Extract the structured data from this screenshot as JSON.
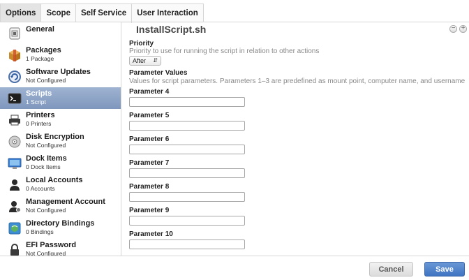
{
  "tabs": [
    "Options",
    "Scope",
    "Self Service",
    "User Interaction"
  ],
  "sidebar": {
    "items": [
      {
        "label": "General",
        "sub": "",
        "icon": "general-icon"
      },
      {
        "label": "Packages",
        "sub": "1 Package",
        "icon": "package-icon"
      },
      {
        "label": "Software Updates",
        "sub": "Not Configured",
        "icon": "software-updates-icon"
      },
      {
        "label": "Scripts",
        "sub": "1 Script",
        "icon": "terminal-icon"
      },
      {
        "label": "Printers",
        "sub": "0 Printers",
        "icon": "printer-icon"
      },
      {
        "label": "Disk Encryption",
        "sub": "Not Configured",
        "icon": "disk-encryption-icon"
      },
      {
        "label": "Dock Items",
        "sub": "0 Dock Items",
        "icon": "dock-icon"
      },
      {
        "label": "Local Accounts",
        "sub": "0 Accounts",
        "icon": "user-icon"
      },
      {
        "label": "Management Account",
        "sub": "Not Configured",
        "icon": "management-account-icon"
      },
      {
        "label": "Directory Bindings",
        "sub": "0 Bindings",
        "icon": "directory-bindings-icon"
      },
      {
        "label": "EFI Password",
        "sub": "Not Configured",
        "icon": "lock-icon"
      }
    ],
    "selected": "Scripts"
  },
  "main": {
    "script_title": "InstallScript.sh",
    "priority_heading": "Priority",
    "priority_desc": "Priority to use for running the script in relation to other actions",
    "priority_value": "After",
    "params_heading": "Parameter Values",
    "params_desc": "Values for script parameters. Parameters 1–3 are predefined as mount point, computer name, and username",
    "params": [
      {
        "label": "Parameter 4",
        "value": ""
      },
      {
        "label": "Parameter 5",
        "value": ""
      },
      {
        "label": "Parameter 6",
        "value": ""
      },
      {
        "label": "Parameter 7",
        "value": ""
      },
      {
        "label": "Parameter 8",
        "value": ""
      },
      {
        "label": "Parameter 9",
        "value": ""
      },
      {
        "label": "Parameter 10",
        "value": ""
      }
    ],
    "remove_symbol": "−",
    "add_symbol": "+"
  },
  "footer": {
    "cancel_label": "Cancel",
    "save_label": "Save"
  },
  "colors": {
    "selected_bg": "#8ea3c7",
    "save_button": "#4a7fc9"
  }
}
